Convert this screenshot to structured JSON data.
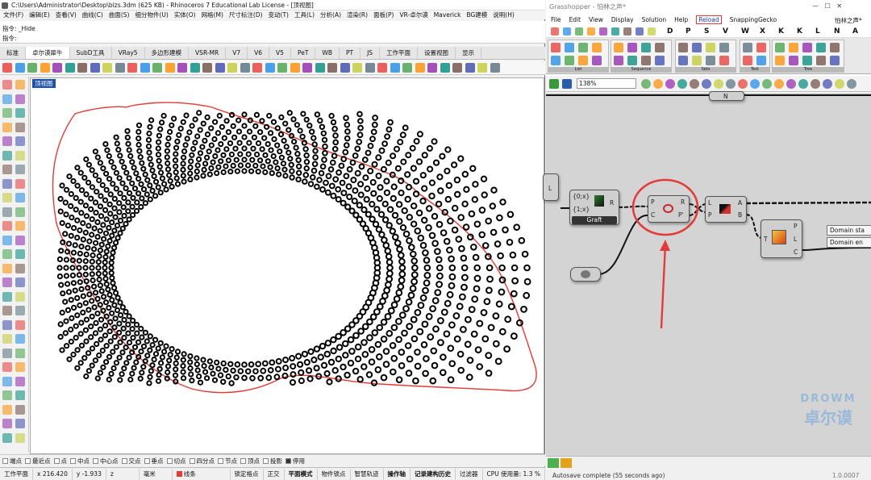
{
  "rhino": {
    "title": "C:\\Users\\Administrator\\Desktop\\blzs.3dm (625 KB) - Rhinoceros 7 Educational Lab License - [顶视图]",
    "menu": [
      "文件(F)",
      "编辑(E)",
      "查看(V)",
      "曲线(C)",
      "曲面(S)",
      "细分物件(U)",
      "实体(O)",
      "网格(M)",
      "尺寸标注(D)",
      "变动(T)",
      "工具(L)",
      "分析(A)",
      "渲染(R)",
      "面板(P)",
      "VR-卓尔谟",
      "Maverick",
      "BG建模",
      "说明(H)"
    ],
    "command_history": "指令: _Hide",
    "command_prompt": "指令:",
    "tabs": [
      "标准",
      "卓尔谟犀牛",
      "SubD工具",
      "VRay5",
      "多边形建模",
      "VSR-MR",
      "V7",
      "V6",
      "V5",
      "PeT",
      "WB",
      "PT",
      "JS",
      "工作平面",
      "设置视图",
      "显示"
    ],
    "active_tab": "卓尔谟犀牛",
    "viewport_label": "顶视图",
    "snaps": [
      {
        "label": "端点",
        "on": false
      },
      {
        "label": "最近点",
        "on": false
      },
      {
        "label": "点",
        "on": false
      },
      {
        "label": "中点",
        "on": false
      },
      {
        "label": "中心点",
        "on": false
      },
      {
        "label": "交点",
        "on": false
      },
      {
        "label": "垂点",
        "on": false
      },
      {
        "label": "切点",
        "on": false
      },
      {
        "label": "四分点",
        "on": false
      },
      {
        "label": "节点",
        "on": false
      },
      {
        "label": "顶点",
        "on": false
      },
      {
        "label": "投影",
        "on": false
      },
      {
        "label": "停用",
        "on": true
      }
    ],
    "status": {
      "plane": "工作平面",
      "x": "x 216.420",
      "y": "y -1.933",
      "z": "z",
      "unit": "毫米",
      "layer": "线条",
      "items": [
        "锁定格点",
        "正交",
        "平面模式",
        "物件锁点",
        "智慧轨迹",
        "操作轴",
        "记录建构历史",
        "过滤器",
        "CPU 使用量: 1.3 %"
      ],
      "bold_items": [
        "平面模式",
        "操作轴",
        "记录建构历史"
      ],
      "layer_color": "#e53935"
    }
  },
  "grasshopper": {
    "title": "Grasshopper - 怕林之声*",
    "menu": [
      "File",
      "Edit",
      "View",
      "Display",
      "Solution",
      "Help",
      "Reload",
      "SnappingGecko"
    ],
    "doc_name": "怕林之声*",
    "tab_letters": [
      "D",
      "P",
      "S",
      "V",
      "W",
      "X",
      "K",
      "K",
      "L",
      "N",
      "A"
    ],
    "panel_captions": [
      "List",
      "Sequence",
      "Sets",
      "Text",
      "Tree"
    ],
    "zoom": "138%",
    "canvas": {
      "graft": {
        "in1": "{0;x}",
        "in2": "{1;x}",
        "out": "R",
        "label": "Graft"
      },
      "highlighted": {
        "in1": "P",
        "in2": "C",
        "out1": "R",
        "out2": "P'"
      },
      "next": {
        "in1": "L",
        "in2": "P",
        "out1": "A",
        "out2": "B"
      },
      "right": {
        "in": "T",
        "out1": "P",
        "out2": "L",
        "out3": "C"
      },
      "left_stub": "L",
      "top_stub": "N",
      "panels": [
        "Domain sta",
        "Domain en"
      ]
    },
    "status": "Autosave complete (55 seconds ago)",
    "version": "1.0.0007",
    "watermark": [
      "DROWM",
      "卓尔谟"
    ],
    "accent": "#e23b3b"
  }
}
